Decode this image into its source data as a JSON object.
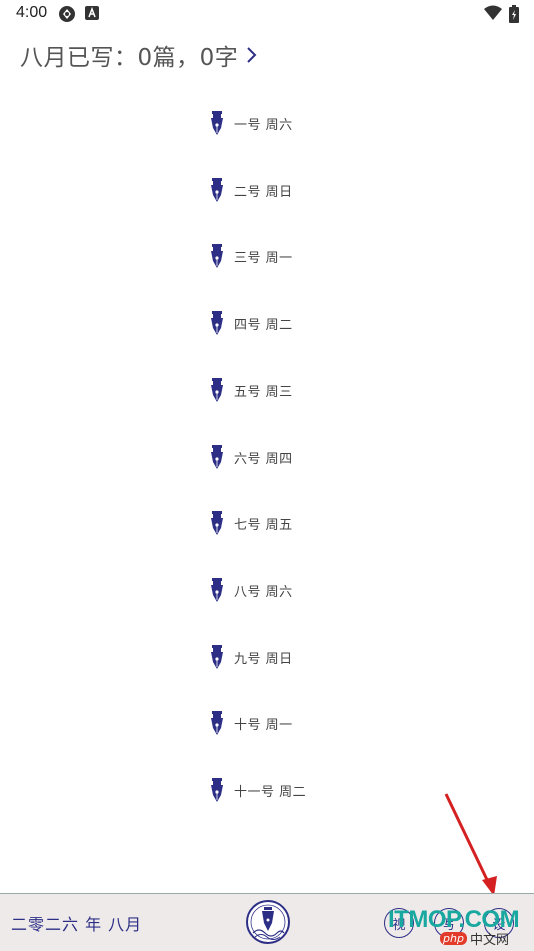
{
  "status_bar": {
    "time": "4:00"
  },
  "header": {
    "summary": "八月已写：0篇，0字"
  },
  "days": [
    {
      "label": "一号 周六"
    },
    {
      "label": "二号 周日"
    },
    {
      "label": "三号 周一"
    },
    {
      "label": "四号 周二"
    },
    {
      "label": "五号 周三"
    },
    {
      "label": "六号 周四"
    },
    {
      "label": "七号 周五"
    },
    {
      "label": "八号 周六"
    },
    {
      "label": "九号 周日"
    },
    {
      "label": "十号 周一"
    },
    {
      "label": "十一号 周二"
    }
  ],
  "bottom_bar": {
    "date": "二零二六 年 八月",
    "buttons": [
      "视",
      "写",
      "设"
    ]
  },
  "watermark": {
    "main": "ITMOP.COM",
    "php": "php",
    "cn": "中文网"
  },
  "colors": {
    "accent": "#2d2f86",
    "bar_bg": "#efeaea",
    "annotation_arrow": "#d42020"
  }
}
